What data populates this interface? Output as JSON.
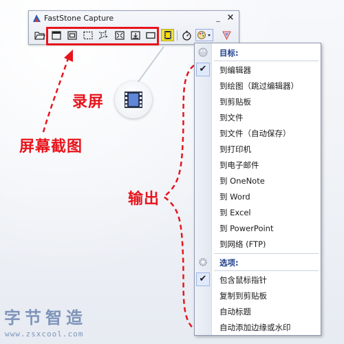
{
  "window": {
    "title": "FastStone Capture",
    "min_symbol": "_",
    "close_symbol": "×"
  },
  "toolbar": {
    "buttons": [
      {
        "name": "open-file-icon"
      },
      {
        "name": "capture-active-window-icon"
      },
      {
        "name": "capture-window-object-icon"
      },
      {
        "name": "capture-rectangular-region-icon"
      },
      {
        "name": "capture-freehand-region-icon"
      },
      {
        "name": "capture-full-screen-icon"
      },
      {
        "name": "capture-scrolling-window-icon"
      },
      {
        "name": "capture-fixed-region-icon"
      },
      {
        "name": "screen-recorder-icon"
      },
      {
        "name": "timer-icon"
      },
      {
        "name": "output-menu-icon"
      },
      {
        "name": "settings-icon"
      }
    ]
  },
  "annotations": {
    "record": "录屏",
    "screen_capture": "屏幕截图",
    "output": "输出"
  },
  "menu": {
    "target_header": "目标:",
    "options_header": "选项:",
    "target_items": [
      {
        "label": "到编辑器",
        "checked": true
      },
      {
        "label": "到绘图（跳过编辑器）",
        "checked": false
      },
      {
        "label": "到剪贴板",
        "checked": false
      },
      {
        "label": "到文件",
        "checked": false
      },
      {
        "label": "到文件（自动保存）",
        "checked": false
      },
      {
        "label": "到打印机",
        "checked": false
      },
      {
        "label": "到电子邮件",
        "checked": false
      },
      {
        "label": "到 OneNote",
        "checked": false
      },
      {
        "label": "到 Word",
        "checked": false
      },
      {
        "label": "到 Excel",
        "checked": false
      },
      {
        "label": "到 PowerPoint",
        "checked": false
      },
      {
        "label": "到网络 (FTP)",
        "checked": false
      }
    ],
    "option_items": [
      {
        "label": "包含鼠标指针",
        "checked": true
      },
      {
        "label": "复制到剪贴板",
        "checked": false
      },
      {
        "label": "自动标题",
        "checked": false
      },
      {
        "label": "自动添加边缘或水印",
        "checked": false
      }
    ],
    "check_symbol": "✔"
  },
  "watermark": {
    "logo": "字节智造",
    "url": "www.zsxcool.com"
  },
  "colors": {
    "annotation_red": "#e8141c",
    "menu_header_blue": "#1d3f8a",
    "watermark": "#7f94ba"
  }
}
